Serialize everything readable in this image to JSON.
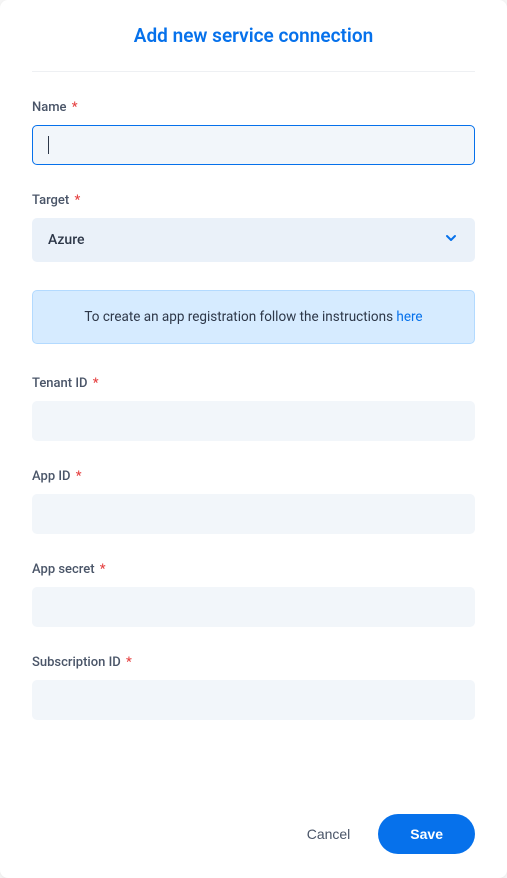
{
  "title": "Add new service connection",
  "fields": {
    "name": {
      "label": "Name",
      "value": ""
    },
    "target": {
      "label": "Target",
      "selected": "Azure"
    },
    "tenant_id": {
      "label": "Tenant ID",
      "value": ""
    },
    "app_id": {
      "label": "App ID",
      "value": ""
    },
    "app_secret": {
      "label": "App secret",
      "value": ""
    },
    "subscription_id": {
      "label": "Subscription ID",
      "value": ""
    }
  },
  "info": {
    "text": "To create an app registration follow the instructions ",
    "link_text": "here"
  },
  "buttons": {
    "cancel": "Cancel",
    "save": "Save"
  },
  "required_marker": "*"
}
